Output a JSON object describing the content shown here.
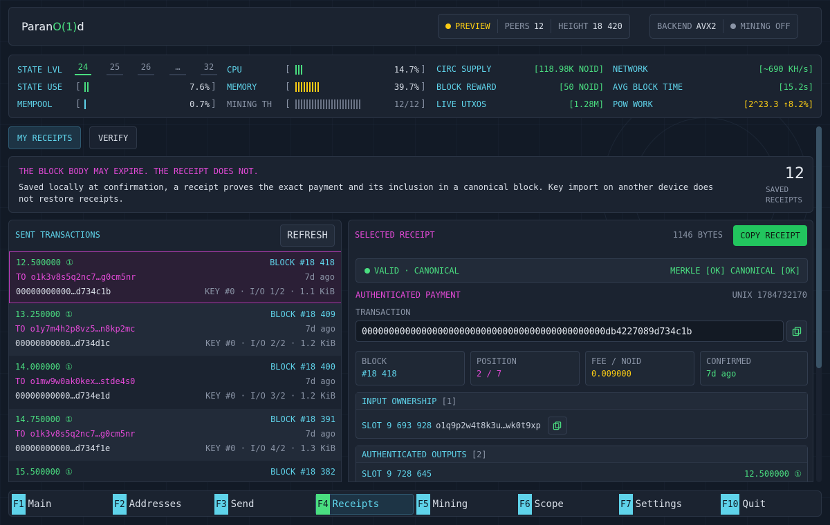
{
  "app": {
    "name_prefix": "Paran",
    "name_o": "O(1)",
    "name_suffix": "d"
  },
  "header": {
    "preview": "PREVIEW",
    "peers_label": "PEERS",
    "peers_value": "12",
    "height_label": "HEIGHT",
    "height_value": "18 420",
    "backend_label": "BACKEND",
    "backend_value": "AVX2",
    "mining": "MINING OFF"
  },
  "stats": {
    "state_lvl_label": "STATE LVL",
    "levels": [
      "24",
      "25",
      "26",
      "…",
      "32"
    ],
    "state_use_label": "STATE USE",
    "state_use_value": "7.6%",
    "state_use_fraction": 0.076,
    "mempool_label": "MEMPOOL",
    "mempool_value": "0.7%",
    "mempool_fraction": 0.007,
    "cpu_label": "CPU",
    "cpu_value": "14.7%",
    "cpu_fraction": 0.147,
    "memory_label": "MEMORY",
    "memory_value": "39.7%",
    "memory_fraction": 0.397,
    "mining_th_label": "MINING TH",
    "mining_th_value": "12/12",
    "circ_supply_label": "CIRC SUPPLY",
    "circ_supply_value": "[118.98K NOID]",
    "block_reward_label": "BLOCK REWARD",
    "block_reward_value": "[50 NOID]",
    "live_utxos_label": "LIVE UTXOS",
    "live_utxos_value": "[1.28M]",
    "network_label": "NETWORK",
    "network_value": "[~690 KH/s]",
    "avg_block_time_label": "AVG BLOCK TIME",
    "avg_block_time_value": "[15.2s]",
    "pow_work_label": "POW WORK",
    "pow_work_value": "[2^23.3 ↑8.2%]"
  },
  "tabs": {
    "my_receipts": "MY RECEIPTS",
    "verify": "VERIFY"
  },
  "notice": {
    "title": "THE BLOCK BODY MAY EXPIRE. THE RECEIPT DOES NOT.",
    "body": "Saved locally at confirmation, a receipt proves the exact payment and its inclusion in a canonical block. Key import on another device does not restore receipts.",
    "count": "12",
    "count_label_1": "SAVED",
    "count_label_2": "RECEIPTS"
  },
  "sent": {
    "title": "SENT TRANSACTIONS",
    "refresh": "REFRESH",
    "items": [
      {
        "amount": "12.500000 ①",
        "block": "BLOCK #18 418",
        "to": "TO o1k3v8s5q2nc7…g0cm5nr",
        "ago": "7d ago",
        "hash": "00000000000…d734c1b",
        "meta": "KEY #0 · I/O 1/2 · 1.1 KiB"
      },
      {
        "amount": "13.250000 ①",
        "block": "BLOCK #18 409",
        "to": "TO o1y7m4h2p8vz5…n8kp2mc",
        "ago": "7d ago",
        "hash": "00000000000…d734d1c",
        "meta": "KEY #0 · I/O 2/2 · 1.2 KiB"
      },
      {
        "amount": "14.000000 ①",
        "block": "BLOCK #18 400",
        "to": "TO o1mw9w0ak0kex…stde4s0",
        "ago": "7d ago",
        "hash": "00000000000…d734e1d",
        "meta": "KEY #0 · I/O 3/2 · 1.2 KiB"
      },
      {
        "amount": "14.750000 ①",
        "block": "BLOCK #18 391",
        "to": "TO o1k3v8s5q2nc7…g0cm5nr",
        "ago": "7d ago",
        "hash": "00000000000…d734f1e",
        "meta": "KEY #0 · I/O 4/2 · 1.3 KiB"
      },
      {
        "amount": "15.500000 ①",
        "block": "BLOCK #18 382",
        "to": "",
        "ago": "",
        "hash": "",
        "meta": ""
      }
    ]
  },
  "receipt": {
    "title": "SELECTED RECEIPT",
    "bytes": "1146 BYTES",
    "copy": "COPY RECEIPT",
    "status": "VALID · CANONICAL",
    "checks": "MERKLE [OK] CANONICAL [OK]",
    "auth_title": "AUTHENTICATED PAYMENT",
    "unix": "UNIX 1784732170",
    "tx_label": "TRANSACTION",
    "tx_id": "000000000000000000000000000000000000000000000db4227089d734c1b",
    "block_label": "BLOCK",
    "block_value": "#18 418",
    "position_label": "POSITION",
    "position_value": "2 / 7",
    "fee_label": "FEE / NOID",
    "fee_value": "0.009000",
    "confirmed_label": "CONFIRMED",
    "confirmed_value": "7d ago",
    "input_title": "INPUT OWNERSHIP",
    "input_count": "[1]",
    "input_slot": "SLOT 9 693 928",
    "input_addr": "o1q9p2w4t8k3u…wk0t9xp",
    "outputs_title": "AUTHENTICATED OUTPUTS",
    "outputs_count": "[2]",
    "output_slot": "SLOT 9 728 645",
    "output_amount": "12.500000 ①"
  },
  "footer": [
    {
      "key": "F1",
      "label": "Main"
    },
    {
      "key": "F2",
      "label": "Addresses"
    },
    {
      "key": "F3",
      "label": "Send"
    },
    {
      "key": "F4",
      "label": "Receipts"
    },
    {
      "key": "F5",
      "label": "Mining"
    },
    {
      "key": "F6",
      "label": "Scope"
    },
    {
      "key": "F7",
      "label": "Settings"
    },
    {
      "key": "F10",
      "label": "Quit"
    }
  ],
  "colors": {
    "accent_cyan": "#5fd3ea",
    "accent_green": "#4ade80",
    "accent_pink": "#e44ad8",
    "accent_yellow": "#facc15"
  }
}
